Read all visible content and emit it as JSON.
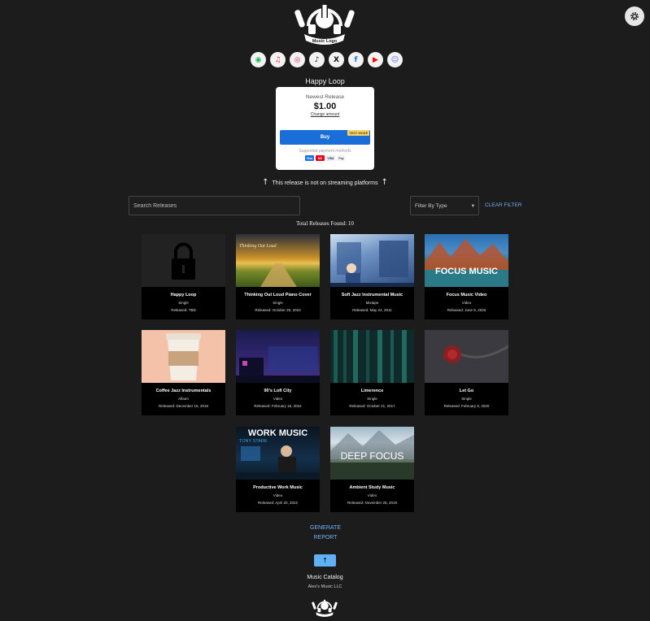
{
  "logo_text": "Music Logo",
  "socials": [
    {
      "name": "spotify-icon",
      "glyph": "◉",
      "color": "#1db954"
    },
    {
      "name": "apple-music-icon",
      "glyph": "♫",
      "color": "#fa2d48"
    },
    {
      "name": "instagram-icon",
      "glyph": "◎",
      "color": "#d62976"
    },
    {
      "name": "tiktok-icon",
      "glyph": "♪",
      "color": "#111111"
    },
    {
      "name": "x-icon",
      "glyph": "X",
      "color": "#111111"
    },
    {
      "name": "facebook-icon",
      "glyph": "f",
      "color": "#1877f2"
    },
    {
      "name": "youtube-icon",
      "glyph": "▶",
      "color": "#ff0000"
    },
    {
      "name": "discord-icon",
      "glyph": "☺",
      "color": "#5865f2"
    }
  ],
  "release": {
    "title": "Happy Loop",
    "label": "Newest Release",
    "price": "$1.00",
    "change_amount": "Change amount",
    "buy": "Buy",
    "test_mode": "TEST MODE",
    "supported": "Supported payment methods",
    "cards": [
      "Visa",
      "MC",
      "VISA",
      "Pay"
    ]
  },
  "stream_note": {
    "arrow_left": "↑",
    "text": "This release is not on streaming platforms",
    "arrow_right": "↑"
  },
  "search": {
    "placeholder": "Search Releases"
  },
  "filter": {
    "label": "Filter By Type",
    "caret": "▾",
    "clear": "CLEAR FILTER"
  },
  "total": "Total Releases Found: 10",
  "releases": [
    {
      "title": "Happy Loop",
      "kind": "Single",
      "date": "Released: TBD"
    },
    {
      "title": "Thinking Out Loud Piano Cover",
      "kind": "Single",
      "date": "Released: October 29, 2023",
      "thumb_text": "Thinking Out Loud"
    },
    {
      "title": "Soft Jazz Instrumental Music",
      "kind": "Mixtape",
      "date": "Released: May 24, 2011"
    },
    {
      "title": "Focus Music Video",
      "kind": "Video",
      "date": "Released: June 9, 2026",
      "thumb_text": "FOCUS MUSIC"
    },
    {
      "title": "Coffee Jazz Instrumentals",
      "kind": "Album",
      "date": "Released: December 15, 2016"
    },
    {
      "title": "90's Lofi City",
      "kind": "Video",
      "date": "Released: February 16, 2024"
    },
    {
      "title": "Limerence",
      "kind": "Single",
      "date": "Released: October 21, 2017"
    },
    {
      "title": "Let Go",
      "kind": "Single",
      "date": "Released: February 6, 2020"
    },
    {
      "title": "Productive Work Music",
      "kind": "Video",
      "date": "Released: April 20, 2022",
      "thumb_text": "WORK MUSIC",
      "thumb_sub": "TONY STARK"
    },
    {
      "title": "Ambient Study Music",
      "kind": "Video",
      "date": "Released: November 25, 2019",
      "thumb_text": "DEEP FOCUS"
    }
  ],
  "generate_report": "GENERATE REPORT",
  "back_to_top": "↑",
  "footer": {
    "title": "Music Catalog",
    "company": "Alex's Music LLC"
  }
}
